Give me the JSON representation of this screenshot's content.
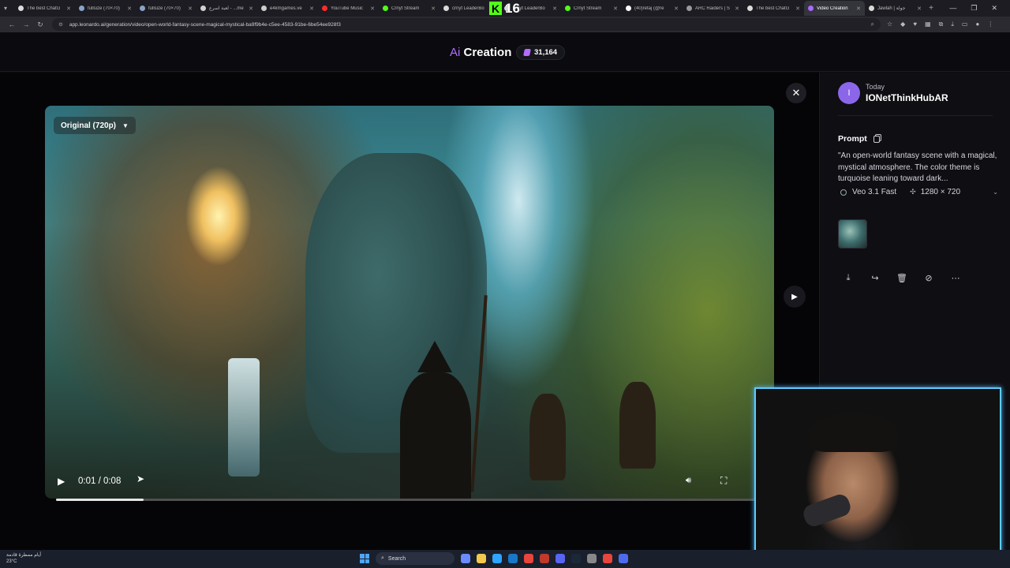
{
  "browser": {
    "tabs": [
      {
        "label": "The best ChatG",
        "color": "#dcdcdc"
      },
      {
        "label": "fullsize (70×70)",
        "color": "#8aa3c7"
      },
      {
        "label": "fullsize (70×70)",
        "color": "#8aa3c7"
      },
      {
        "label": "لعبة اسرع - ...me",
        "color": "#d1d1d1"
      },
      {
        "label": "e4kmgames.ve",
        "color": "#cccccc"
      },
      {
        "label": "YouTube Music",
        "color": "#ff2b2b"
      },
      {
        "label": "Crnyt Stream",
        "color": "#53fc18"
      },
      {
        "label": "crnyt LeaderBo",
        "color": "#d9d9d9"
      },
      {
        "label": "crnyt LeaderBo",
        "color": "#d9d9d9"
      },
      {
        "label": "Crnyt Stream",
        "color": "#53fc18"
      },
      {
        "label": "(40)retaj (@re",
        "color": "#ffffff"
      },
      {
        "label": "ARC Raiders | S",
        "color": "#9a9a9a"
      },
      {
        "label": "The best ChatG",
        "color": "#dcdcdc"
      },
      {
        "label": "Video Creation",
        "color": "#a66bff",
        "active": true
      },
      {
        "label": "Jawlah | جولة",
        "color": "#d9d9d9"
      }
    ],
    "stream_counter": "16",
    "k_logo": "K",
    "url": "app.leonardo.ai/generation/video/open-world-fantasy-scene-magical-mystical-ba9f9b4e-c5ee-4583-91be-6be54ee928f3"
  },
  "header": {
    "ai_label": "Ai",
    "title": "Creation",
    "tokens": "31,164"
  },
  "player": {
    "quality": "Original (720p)",
    "time": "0:01 / 0:08",
    "progress_fraction": 0.125
  },
  "panel": {
    "avatar_letter": "I",
    "date": "Today",
    "username": "IONetThinkHubAR",
    "prompt_heading": "Prompt",
    "prompt_text": "\"An open-world fantasy scene with a magical, mystical atmosphere. The color theme is turquoise leaning toward dark...",
    "model": "Veo 3.1 Fast",
    "dimensions": "1280 × 720"
  },
  "taskbar": {
    "weather_line1": "أيام ممطرة قادمة",
    "weather_line2": "23°C",
    "search_label": "Search"
  }
}
